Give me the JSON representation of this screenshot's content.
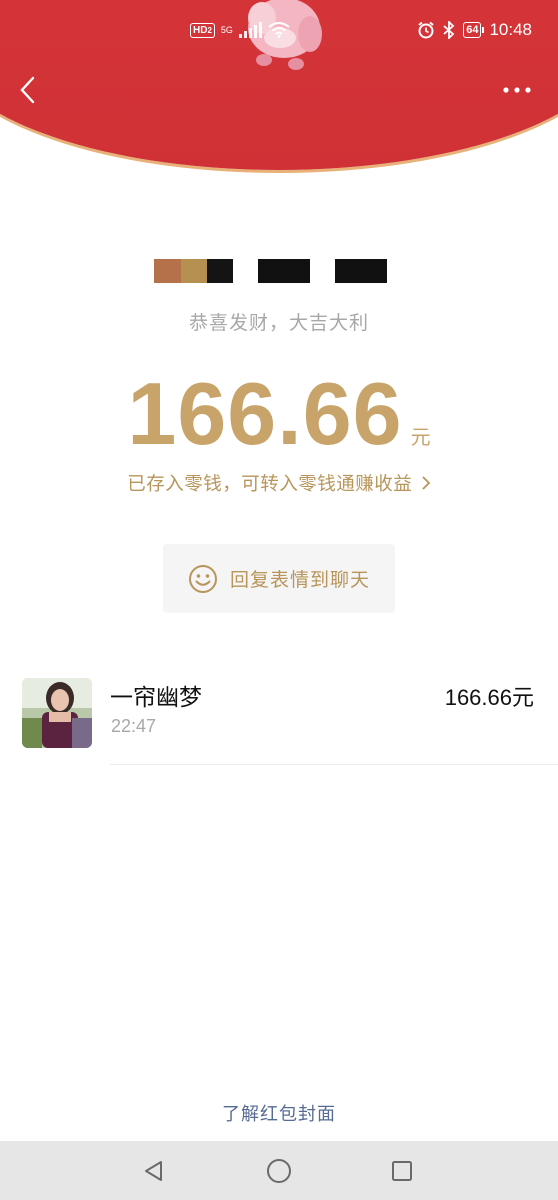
{
  "status_bar": {
    "hd_label": "HD",
    "hd_sub": "2",
    "network_label": "5G",
    "battery_level": "64",
    "time": "10:48",
    "icons": [
      "signal-icon",
      "wifi-icon",
      "alarm-icon",
      "bluetooth-icon",
      "battery-icon"
    ]
  },
  "header": {
    "background_color": "#d43438",
    "accent_border_color": "#e8b178",
    "back_icon": "chevron-left-icon",
    "more_icon": "more-dots-icon"
  },
  "envelope": {
    "greeting": "恭喜发财，大吉大利",
    "amount": "166.66",
    "unit": "元",
    "deposit_text": "已存入零钱，可转入零钱通赚收益",
    "deposit_chevron": "›",
    "accent_color": "#c8a46a"
  },
  "reply": {
    "label": "回复表情到聊天",
    "icon": "smiley-icon"
  },
  "records": [
    {
      "name": "一帘幽梦",
      "time": "22:47",
      "amount": "166.66元"
    }
  ],
  "footer": {
    "cover_link": "了解红包封面"
  },
  "nav_bar": {
    "icons": [
      "back-triangle-icon",
      "home-circle-icon",
      "recents-square-icon"
    ]
  }
}
